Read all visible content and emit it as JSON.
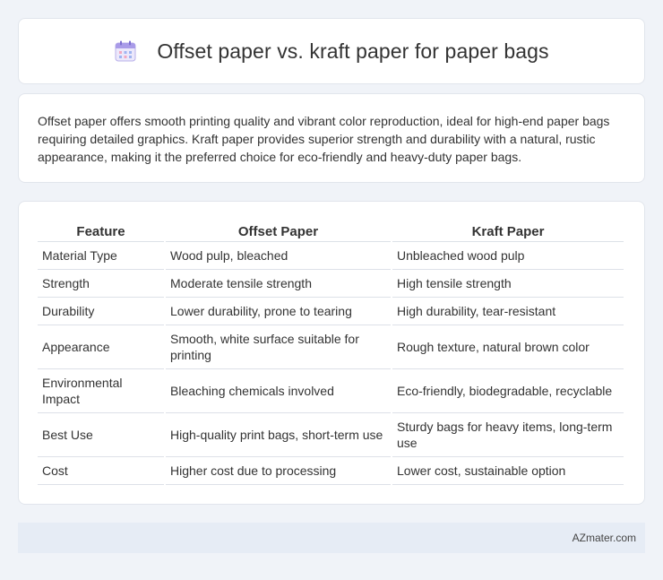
{
  "header": {
    "title": "Offset paper vs. kraft paper for paper bags",
    "icon": "calendar-icon"
  },
  "summary": {
    "text": "Offset paper offers smooth printing quality and vibrant color reproduction, ideal for high-end paper bags requiring detailed graphics. Kraft paper provides superior strength and durability with a natural, rustic appearance, making it the preferred choice for eco-friendly and heavy-duty paper bags."
  },
  "table": {
    "headers": [
      "Feature",
      "Offset Paper",
      "Kraft Paper"
    ],
    "rows": [
      [
        "Material Type",
        "Wood pulp, bleached",
        "Unbleached wood pulp"
      ],
      [
        "Strength",
        "Moderate tensile strength",
        "High tensile strength"
      ],
      [
        "Durability",
        "Lower durability, prone to tearing",
        "High durability, tear-resistant"
      ],
      [
        "Appearance",
        "Smooth, white surface suitable for printing",
        "Rough texture, natural brown color"
      ],
      [
        "Environmental Impact",
        "Bleaching chemicals involved",
        "Eco-friendly, biodegradable, recyclable"
      ],
      [
        "Best Use",
        "High-quality print bags, short-term use",
        "Sturdy bags for heavy items, long-term use"
      ],
      [
        "Cost",
        "Higher cost due to processing",
        "Lower cost, sustainable option"
      ]
    ]
  },
  "footer": {
    "text": "AZmater.com"
  }
}
